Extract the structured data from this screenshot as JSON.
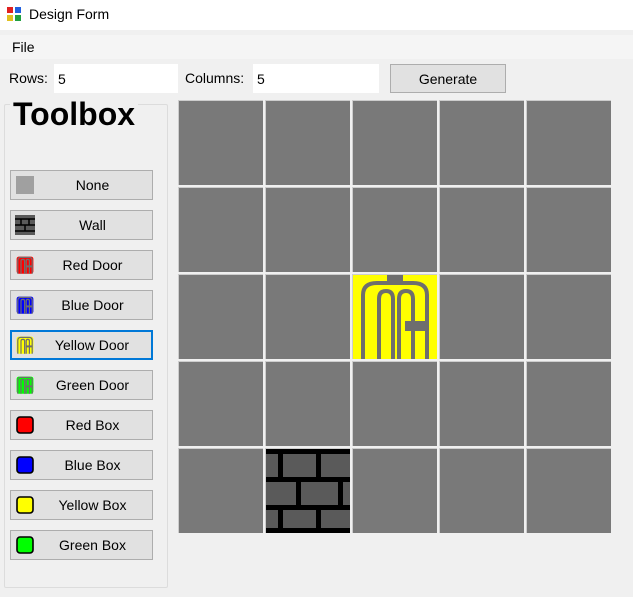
{
  "window": {
    "title": "Design Form"
  },
  "menu": {
    "file": "File"
  },
  "settings": {
    "rows_label": "Rows:",
    "rows_value": "5",
    "columns_label": "Columns:",
    "columns_value": "5",
    "generate_label": "Generate"
  },
  "toolbox": {
    "title": "Toolbox",
    "selected": "Yellow Door",
    "items": [
      {
        "label": "None",
        "icon": "none-tile-icon",
        "color": "#a0a0a0"
      },
      {
        "label": "Wall",
        "icon": "wall-icon",
        "color": "#5a5a5a"
      },
      {
        "label": "Red Door",
        "icon": "red-door-icon",
        "color": "#ff0000"
      },
      {
        "label": "Blue Door",
        "icon": "blue-door-icon",
        "color": "#0000ff"
      },
      {
        "label": "Yellow Door",
        "icon": "yellow-door-icon",
        "color": "#ffff00"
      },
      {
        "label": "Green Door",
        "icon": "green-door-icon",
        "color": "#00ff00"
      },
      {
        "label": "Red Box",
        "icon": "red-box-icon",
        "color": "#ff0000"
      },
      {
        "label": "Blue Box",
        "icon": "blue-box-icon",
        "color": "#0000ff"
      },
      {
        "label": "Yellow Box",
        "icon": "yellow-box-icon",
        "color": "#ffff00"
      },
      {
        "label": "Green Box",
        "icon": "green-box-icon",
        "color": "#00ff00"
      }
    ]
  },
  "grid": {
    "rows": 5,
    "columns": 5,
    "cells": [
      [
        "none",
        "none",
        "none",
        "none",
        "none"
      ],
      [
        "none",
        "none",
        "none",
        "none",
        "none"
      ],
      [
        "none",
        "none",
        "yellow-door",
        "none",
        "none"
      ],
      [
        "none",
        "none",
        "none",
        "none",
        "none"
      ],
      [
        "none",
        "wall",
        "none",
        "none",
        "none"
      ]
    ]
  },
  "colors": {
    "empty_cell": "#797979",
    "grid_line": "#cdcdcd",
    "selected_border": "#0078d7",
    "door_frame": "#6e6e6e"
  }
}
